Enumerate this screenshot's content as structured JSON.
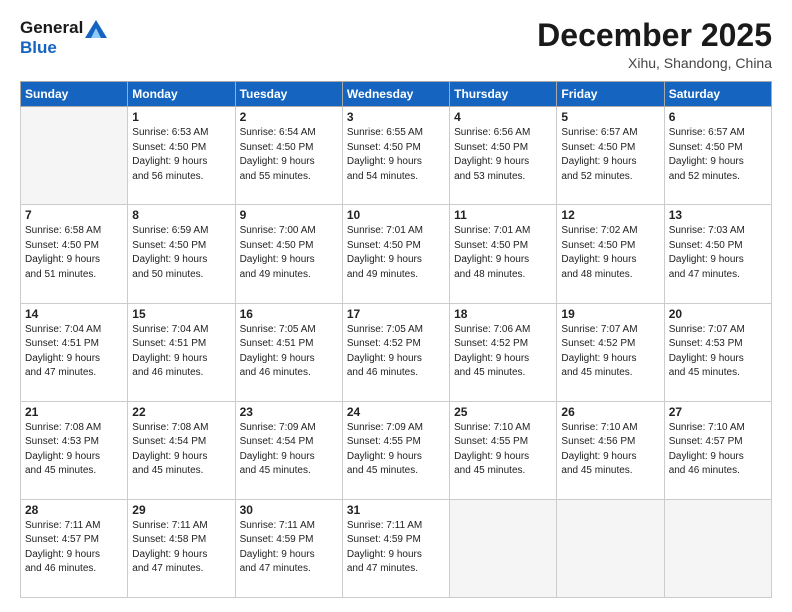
{
  "header": {
    "logo_line1": "General",
    "logo_line2": "Blue",
    "month": "December 2025",
    "location": "Xihu, Shandong, China"
  },
  "weekdays": [
    "Sunday",
    "Monday",
    "Tuesday",
    "Wednesday",
    "Thursday",
    "Friday",
    "Saturday"
  ],
  "weeks": [
    [
      {
        "day": "",
        "info": ""
      },
      {
        "day": "1",
        "info": "Sunrise: 6:53 AM\nSunset: 4:50 PM\nDaylight: 9 hours\nand 56 minutes."
      },
      {
        "day": "2",
        "info": "Sunrise: 6:54 AM\nSunset: 4:50 PM\nDaylight: 9 hours\nand 55 minutes."
      },
      {
        "day": "3",
        "info": "Sunrise: 6:55 AM\nSunset: 4:50 PM\nDaylight: 9 hours\nand 54 minutes."
      },
      {
        "day": "4",
        "info": "Sunrise: 6:56 AM\nSunset: 4:50 PM\nDaylight: 9 hours\nand 53 minutes."
      },
      {
        "day": "5",
        "info": "Sunrise: 6:57 AM\nSunset: 4:50 PM\nDaylight: 9 hours\nand 52 minutes."
      },
      {
        "day": "6",
        "info": "Sunrise: 6:57 AM\nSunset: 4:50 PM\nDaylight: 9 hours\nand 52 minutes."
      }
    ],
    [
      {
        "day": "7",
        "info": "Sunrise: 6:58 AM\nSunset: 4:50 PM\nDaylight: 9 hours\nand 51 minutes."
      },
      {
        "day": "8",
        "info": "Sunrise: 6:59 AM\nSunset: 4:50 PM\nDaylight: 9 hours\nand 50 minutes."
      },
      {
        "day": "9",
        "info": "Sunrise: 7:00 AM\nSunset: 4:50 PM\nDaylight: 9 hours\nand 49 minutes."
      },
      {
        "day": "10",
        "info": "Sunrise: 7:01 AM\nSunset: 4:50 PM\nDaylight: 9 hours\nand 49 minutes."
      },
      {
        "day": "11",
        "info": "Sunrise: 7:01 AM\nSunset: 4:50 PM\nDaylight: 9 hours\nand 48 minutes."
      },
      {
        "day": "12",
        "info": "Sunrise: 7:02 AM\nSunset: 4:50 PM\nDaylight: 9 hours\nand 48 minutes."
      },
      {
        "day": "13",
        "info": "Sunrise: 7:03 AM\nSunset: 4:50 PM\nDaylight: 9 hours\nand 47 minutes."
      }
    ],
    [
      {
        "day": "14",
        "info": "Sunrise: 7:04 AM\nSunset: 4:51 PM\nDaylight: 9 hours\nand 47 minutes."
      },
      {
        "day": "15",
        "info": "Sunrise: 7:04 AM\nSunset: 4:51 PM\nDaylight: 9 hours\nand 46 minutes."
      },
      {
        "day": "16",
        "info": "Sunrise: 7:05 AM\nSunset: 4:51 PM\nDaylight: 9 hours\nand 46 minutes."
      },
      {
        "day": "17",
        "info": "Sunrise: 7:05 AM\nSunset: 4:52 PM\nDaylight: 9 hours\nand 46 minutes."
      },
      {
        "day": "18",
        "info": "Sunrise: 7:06 AM\nSunset: 4:52 PM\nDaylight: 9 hours\nand 45 minutes."
      },
      {
        "day": "19",
        "info": "Sunrise: 7:07 AM\nSunset: 4:52 PM\nDaylight: 9 hours\nand 45 minutes."
      },
      {
        "day": "20",
        "info": "Sunrise: 7:07 AM\nSunset: 4:53 PM\nDaylight: 9 hours\nand 45 minutes."
      }
    ],
    [
      {
        "day": "21",
        "info": "Sunrise: 7:08 AM\nSunset: 4:53 PM\nDaylight: 9 hours\nand 45 minutes."
      },
      {
        "day": "22",
        "info": "Sunrise: 7:08 AM\nSunset: 4:54 PM\nDaylight: 9 hours\nand 45 minutes."
      },
      {
        "day": "23",
        "info": "Sunrise: 7:09 AM\nSunset: 4:54 PM\nDaylight: 9 hours\nand 45 minutes."
      },
      {
        "day": "24",
        "info": "Sunrise: 7:09 AM\nSunset: 4:55 PM\nDaylight: 9 hours\nand 45 minutes."
      },
      {
        "day": "25",
        "info": "Sunrise: 7:10 AM\nSunset: 4:55 PM\nDaylight: 9 hours\nand 45 minutes."
      },
      {
        "day": "26",
        "info": "Sunrise: 7:10 AM\nSunset: 4:56 PM\nDaylight: 9 hours\nand 45 minutes."
      },
      {
        "day": "27",
        "info": "Sunrise: 7:10 AM\nSunset: 4:57 PM\nDaylight: 9 hours\nand 46 minutes."
      }
    ],
    [
      {
        "day": "28",
        "info": "Sunrise: 7:11 AM\nSunset: 4:57 PM\nDaylight: 9 hours\nand 46 minutes."
      },
      {
        "day": "29",
        "info": "Sunrise: 7:11 AM\nSunset: 4:58 PM\nDaylight: 9 hours\nand 47 minutes."
      },
      {
        "day": "30",
        "info": "Sunrise: 7:11 AM\nSunset: 4:59 PM\nDaylight: 9 hours\nand 47 minutes."
      },
      {
        "day": "31",
        "info": "Sunrise: 7:11 AM\nSunset: 4:59 PM\nDaylight: 9 hours\nand 47 minutes."
      },
      {
        "day": "",
        "info": ""
      },
      {
        "day": "",
        "info": ""
      },
      {
        "day": "",
        "info": ""
      }
    ]
  ]
}
